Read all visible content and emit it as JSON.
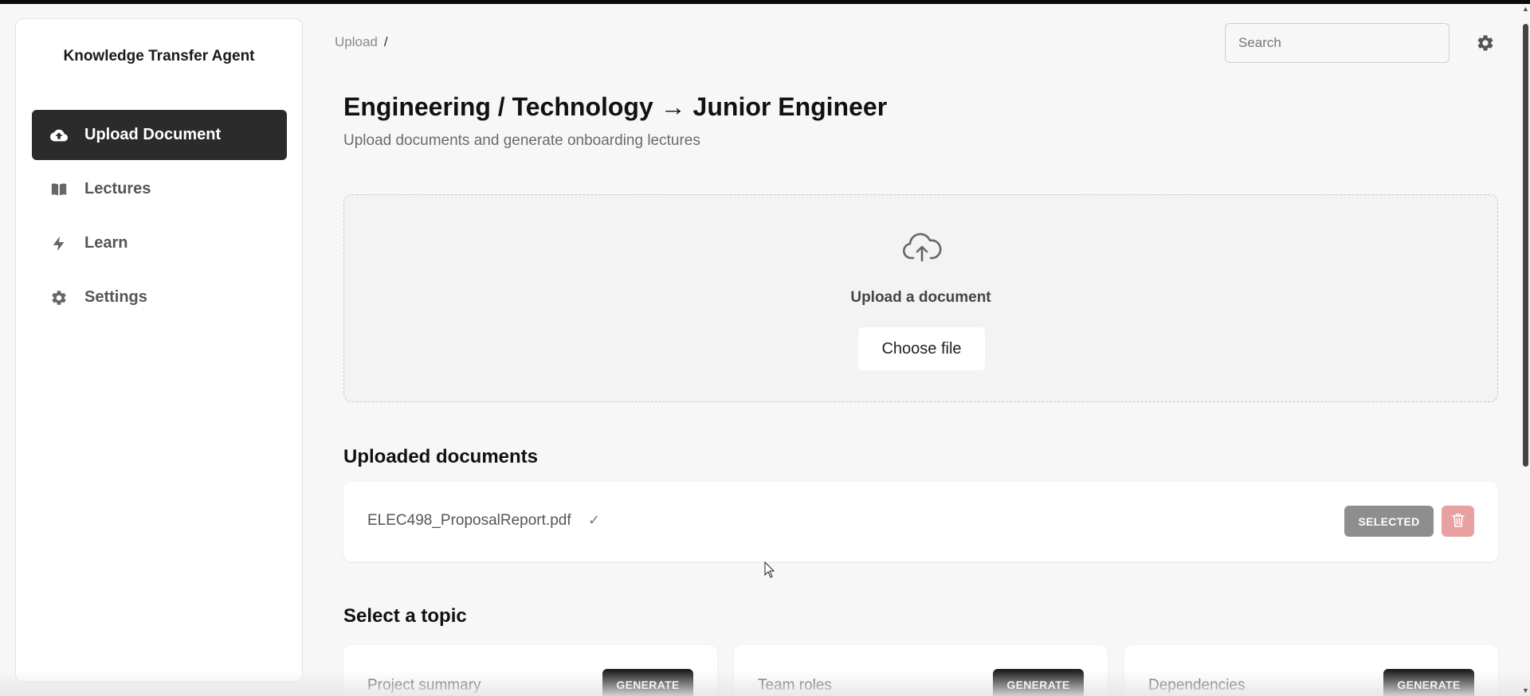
{
  "app": {
    "brand": "Knowledge Transfer Agent"
  },
  "sidebar": {
    "items": [
      {
        "label": "Upload Document",
        "icon": "cloud-upload-icon",
        "active": true
      },
      {
        "label": "Lectures",
        "icon": "book-icon",
        "active": false
      },
      {
        "label": "Learn",
        "icon": "lightning-icon",
        "active": false
      },
      {
        "label": "Settings",
        "icon": "gear-icon",
        "active": false
      }
    ]
  },
  "header": {
    "breadcrumb": "Upload",
    "breadcrumb_sep": "/",
    "search_placeholder": "Search",
    "settings_icon": "gear-icon"
  },
  "main": {
    "title": "Engineering / Technology → Junior Engineer",
    "subtitle": "Upload documents and generate onboarding lectures",
    "upload": {
      "icon": "cloud-upload-icon",
      "label": "Upload a document",
      "button": "Choose file"
    },
    "uploaded_title": "Uploaded documents",
    "documents": [
      {
        "name": "ELEC498_ProposalReport.pdf",
        "check": "✓",
        "status": "SELECTED",
        "delete_icon": "trash-icon"
      }
    ],
    "topic_title": "Select a topic",
    "topics": [
      {
        "name": "Project summary",
        "button": "GENERATE"
      },
      {
        "name": "Team roles",
        "button": "GENERATE"
      },
      {
        "name": "Dependencies",
        "button": "GENERATE"
      }
    ]
  },
  "colors": {
    "active_nav": "#2b2b2b",
    "selected_badge": "#8e8e8e",
    "delete_button": "#e8a0a0",
    "generate_button": "#1f1f1f"
  }
}
